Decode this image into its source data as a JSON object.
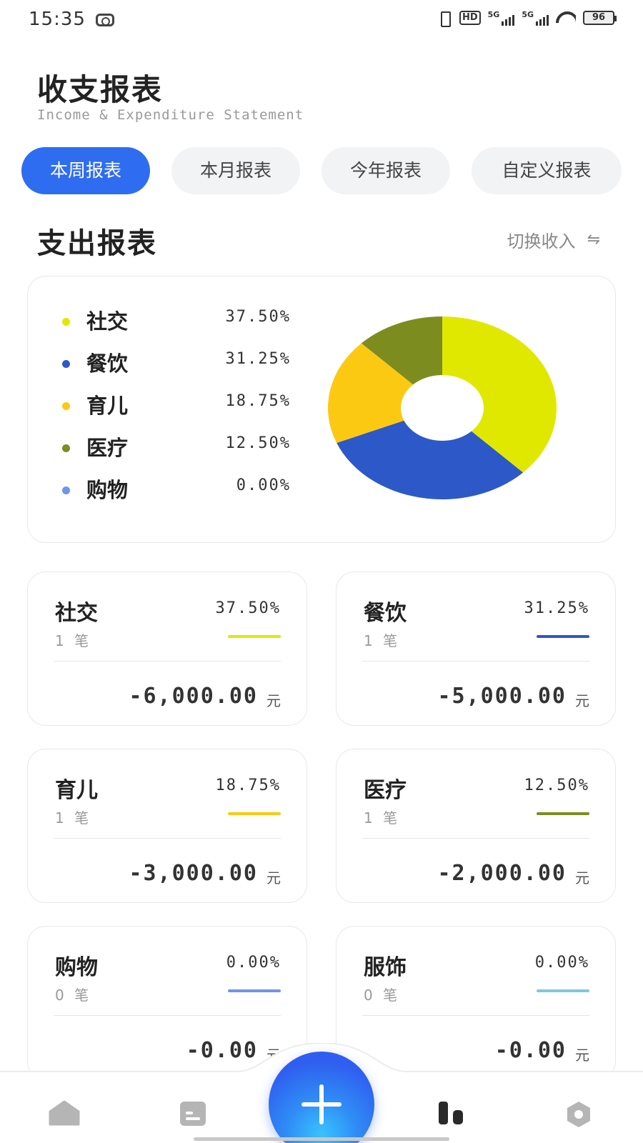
{
  "status_bar": {
    "time": "15:35",
    "hd_label": "HD",
    "sig1_label": "5G",
    "sig2_label": "5G",
    "battery": "96"
  },
  "header": {
    "title": "收支报表",
    "subtitle": "Income & Expenditure Statement"
  },
  "tabs": [
    {
      "label": "本周报表",
      "active": true
    },
    {
      "label": "本月报表",
      "active": false
    },
    {
      "label": "今年报表",
      "active": false
    },
    {
      "label": "自定义报表",
      "active": false
    }
  ],
  "section": {
    "title": "支出报表",
    "switch_label": "切换收入",
    "switch_icon": "⇋"
  },
  "legend": [
    {
      "label": "社交",
      "pct": "37.50%",
      "color": "#e1e800"
    },
    {
      "label": "餐饮",
      "pct": "31.25%",
      "color": "#2d58c8"
    },
    {
      "label": "育儿",
      "pct": "18.75%",
      "color": "#fbc912"
    },
    {
      "label": "医疗",
      "pct": "12.50%",
      "color": "#7d8c1f"
    },
    {
      "label": "购物",
      "pct": "0.00%",
      "color": "#6f94ea"
    }
  ],
  "chart_data": {
    "type": "pie",
    "donut": true,
    "title": "",
    "categories": [
      "社交",
      "餐饮",
      "育儿",
      "医疗",
      "购物"
    ],
    "values": [
      37.5,
      31.25,
      18.75,
      12.5,
      0.0
    ],
    "colors": [
      "#e1e800",
      "#2d58c8",
      "#fbc912",
      "#7d8c1f",
      "#6f94ea"
    ],
    "legend_position": "left"
  },
  "cards": [
    {
      "name": "社交",
      "pct": "37.50%",
      "count": "1 笔",
      "amount": "-6,000.00",
      "unit": "元",
      "color": "#e1e800"
    },
    {
      "name": "餐饮",
      "pct": "31.25%",
      "count": "1 笔",
      "amount": "-5,000.00",
      "unit": "元",
      "color": "#2d58c8"
    },
    {
      "name": "育儿",
      "pct": "18.75%",
      "count": "1 笔",
      "amount": "-3,000.00",
      "unit": "元",
      "color": "#fbc912"
    },
    {
      "name": "医疗",
      "pct": "12.50%",
      "count": "1 笔",
      "amount": "-2,000.00",
      "unit": "元",
      "color": "#7d8c1f"
    },
    {
      "name": "购物",
      "pct": "0.00%",
      "count": "0 笔",
      "amount": "-0.00",
      "unit": "元",
      "color": "#6f94ea"
    },
    {
      "name": "服饰",
      "pct": "0.00%",
      "count": "0 笔",
      "amount": "-0.00",
      "unit": "元",
      "color": "#7cc8e0"
    }
  ],
  "bottom_nav": {
    "items": [
      "home-icon",
      "bill-icon",
      "add-icon",
      "chart-icon",
      "settings-icon"
    ],
    "active": "chart-icon",
    "accent": "#2f6df0"
  }
}
